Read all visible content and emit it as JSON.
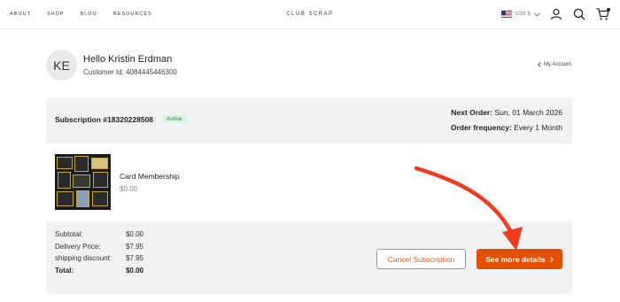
{
  "header": {
    "nav": [
      "ABOUT",
      "SHOP",
      "BLOG",
      "RESOURCES"
    ],
    "brand": "CLUB SCRAP",
    "currency": "USD $",
    "icons": [
      "account-icon",
      "search-icon",
      "cart-icon"
    ]
  },
  "profile": {
    "initials": "KE",
    "greeting": "Hello Kristin Erdman",
    "customer_id": "Customer Id: 4084445446300",
    "my_account": "My Account"
  },
  "subscription": {
    "title": "Subscription #18320228508",
    "status": "Active",
    "status_color": "#2d8a43",
    "next_order_label": "Next Order:",
    "next_order_value": "Sun, 01 March 2026",
    "frequency_label": "Order frequency:",
    "frequency_value": "Every 1 Month",
    "item": {
      "name": "Card Membership",
      "price": "$0.00"
    },
    "totals": [
      {
        "label": "Subtotal:",
        "value": "$0.00"
      },
      {
        "label": "Delivery Price:",
        "value": "$7.95"
      },
      {
        "label": "shipping discount:",
        "value": "$7.95"
      },
      {
        "label": "Total:",
        "value": "$0.00"
      }
    ],
    "cancel_label": "Cancel Subscription",
    "more_label": "See more details",
    "accent_color": "#e35100"
  }
}
